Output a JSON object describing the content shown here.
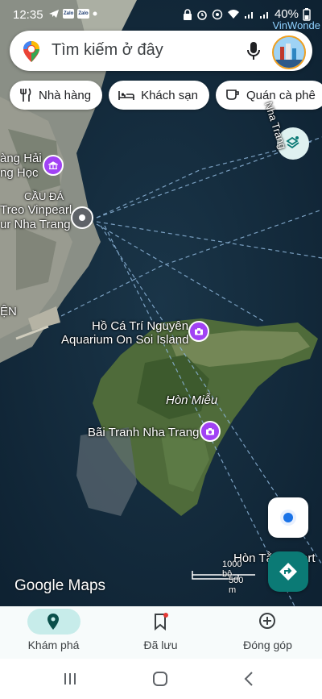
{
  "status_bar": {
    "time": "12:35",
    "zalo_badge_1": "Zalo",
    "zalo_badge_2": "Zalo",
    "battery": "40%"
  },
  "search": {
    "placeholder": "Tìm kiếm ở đây",
    "avatar_caption": "VinWonde"
  },
  "chips": [
    {
      "label": "Nhà hàng",
      "icon": "restaurant-icon"
    },
    {
      "label": "Khách sạn",
      "icon": "hotel-icon"
    },
    {
      "label": "Quán cà phê",
      "icon": "cafe-icon"
    }
  ],
  "map_labels": {
    "road_nha_trang": "Nha Trang",
    "hai_line1": "àng Hải",
    "hai_line2": "ng Học",
    "cau_da": "CẦU ĐÁ",
    "treo_line1": "Treo Vinpearl",
    "treo_line2": "ur Nha Trang",
    "ven": "ỆN",
    "aquarium_line1": "Hồ Cá Trí Nguyên",
    "aquarium_line2": "Aquarium On Soi Island",
    "hon_mieu": "Hòn Miễu",
    "bai_tranh": "Bãi Tranh Nha Trang",
    "hon_tam": "Hòn Tằ",
    "resort": "ort"
  },
  "map_brand": "Google Maps",
  "scale": {
    "top": "1000 bộ",
    "bottom": "500 m"
  },
  "bottom_nav": [
    {
      "label": "Khám phá",
      "icon": "explore-pin-icon",
      "active": true
    },
    {
      "label": "Đã lưu",
      "icon": "bookmark-icon",
      "active": false
    },
    {
      "label": "Đóng góp",
      "icon": "add-circle-icon",
      "active": false
    }
  ],
  "colors": {
    "accent": "#0b7a75",
    "nav_active_pill": "#c7ecea",
    "poi": "#a142f4"
  }
}
